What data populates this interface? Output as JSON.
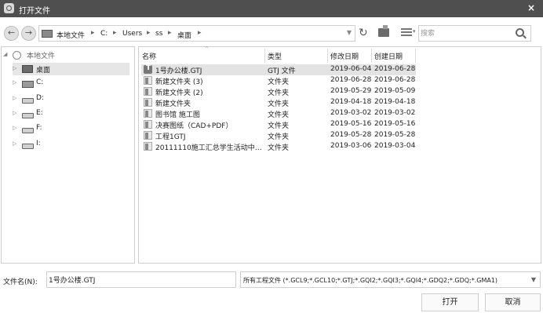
{
  "window": {
    "title": "打开文件",
    "close_label": "×"
  },
  "address": {
    "crumbs": [
      "本地文件",
      "C:",
      "Users",
      "ss",
      "桌面"
    ],
    "separator": "▸"
  },
  "search": {
    "placeholder": "搜索"
  },
  "sidebar": {
    "root_label": "本地文件",
    "items": [
      {
        "label": "桌面",
        "icon": "desktop-icon",
        "selected": true
      },
      {
        "label": "C:",
        "icon": "system-drive-icon"
      },
      {
        "label": "D:",
        "icon": "drive-icon"
      },
      {
        "label": "E:",
        "icon": "drive-icon"
      },
      {
        "label": "F:",
        "icon": "drive-icon"
      },
      {
        "label": "I:",
        "icon": "drive-icon"
      }
    ]
  },
  "filelist": {
    "columns": [
      "名称",
      "类型",
      "修改日期",
      "创建日期"
    ],
    "rows": [
      {
        "name": "1号办公楼.GTJ",
        "type": "GTJ 文件",
        "modified": "2019-06-04",
        "created": "2019-06-28",
        "icon": "gtj-file-icon",
        "selected": true
      },
      {
        "name": "新建文件夹 (3)",
        "type": "文件夹",
        "modified": "2019-06-28",
        "created": "2019-06-28",
        "icon": "folder-icon"
      },
      {
        "name": "新建文件夹 (2)",
        "type": "文件夹",
        "modified": "2019-05-29",
        "created": "2019-05-09",
        "icon": "folder-icon"
      },
      {
        "name": "新建文件夹",
        "type": "文件夹",
        "modified": "2019-04-18",
        "created": "2019-04-18",
        "icon": "folder-icon"
      },
      {
        "name": "图书馆 施工图",
        "type": "文件夹",
        "modified": "2019-03-02",
        "created": "2019-03-02",
        "icon": "folder-icon"
      },
      {
        "name": "决赛图纸（CAD+PDF）",
        "type": "文件夹",
        "modified": "2019-05-16",
        "created": "2019-05-16",
        "icon": "folder-icon"
      },
      {
        "name": "工程1GTJ",
        "type": "文件夹",
        "modified": "2019-05-28",
        "created": "2019-05-28",
        "icon": "folder-icon"
      },
      {
        "name": "20111110施工汇总学生活动中…",
        "type": "文件夹",
        "modified": "2019-03-06",
        "created": "2019-03-04",
        "icon": "folder-icon"
      }
    ]
  },
  "footer": {
    "filename_label": "文件名(N):",
    "filename_value": "1号办公楼.GTJ",
    "filetype_value": "所有工程文件 (*.GCL9;*.GCL10;*.GTJ;*.GQI2;*.GQI3;*.GQI4;*.GDQ2;*.GDQ;*.GMA1)",
    "open_label": "打开",
    "cancel_label": "取消"
  },
  "colors": {
    "titlebar": "#4f4f4f",
    "selection": "#e3e3e3",
    "border": "#cfcfcf"
  }
}
